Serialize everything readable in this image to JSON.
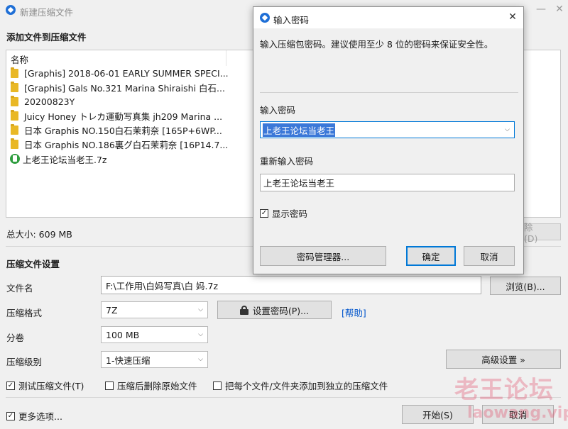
{
  "window": {
    "title": "新建压缩文件",
    "minimize_glyph": "—",
    "close_glyph": "✕"
  },
  "add_files": {
    "heading": "添加文件到压缩文件",
    "column_name": "名称",
    "items": [
      {
        "name": "[Graphis] 2018-06-01 EARLY SUMMER SPECI...",
        "icon": "folder-icon"
      },
      {
        "name": "[Graphis] Gals No.321 Marina Shiraishi 白石...",
        "icon": "folder-icon"
      },
      {
        "name": "20200823Y",
        "icon": "folder-icon"
      },
      {
        "name": "Juicy Honey トレカ運動写真集 jh209 Marina ...",
        "icon": "folder-icon"
      },
      {
        "name": "日本 Graphis NO.150白石茉莉奈 [165P+6WP...",
        "icon": "folder-icon"
      },
      {
        "name": "日本 Graphis NO.186裏グ白石茉莉奈 [16P14.7...",
        "icon": "folder-icon"
      },
      {
        "name": "上老王论坛当老王.7z",
        "icon": "archive-icon"
      }
    ],
    "total_size": "总大小: 609 MB",
    "delete_button": "除(D)"
  },
  "settings": {
    "heading": "压缩文件设置",
    "filename_label": "文件名",
    "filename_value": "F:\\工作用\\白妈写真\\白 妈.7z",
    "browse_button": "浏览(B)...",
    "format_label": "压缩格式",
    "format_value": "7Z",
    "set_password_button": "设置密码(P)...",
    "help_link": "[帮助]",
    "split_label": "分卷",
    "split_value": "100 MB",
    "level_label": "压缩级别",
    "level_value": "1-快速压缩",
    "advanced_button": "高级设置 »",
    "test_archive": "测试压缩文件(T)",
    "delete_source": "压缩后删除原始文件",
    "separate_archives": "把每个文件/文件夹添加到独立的压缩文件",
    "more_options": "更多选项...",
    "start_button": "开始(S)",
    "cancel_button": "取消"
  },
  "dialog": {
    "title": "输入密码",
    "close_glyph": "✕",
    "description": "输入压缩包密码。建议使用至少 8 位的密码来保证安全性。",
    "password_label": "输入密码",
    "password_value": "上老王论坛当老王",
    "confirm_label": "重新输入密码",
    "confirm_value": "上老王论坛当老王",
    "show_password": "显示密码",
    "password_manager_button": "密码管理器...",
    "ok_button": "确定",
    "cancel_button": "取消"
  },
  "watermark": {
    "line1": "老王论坛",
    "line2": "laowang.vip"
  },
  "colors": {
    "accent": "#0078d7",
    "folder": "#e9b826",
    "archive": "#2e9d3e",
    "selection": "#3b78d8",
    "watermark": "#e2506e"
  }
}
